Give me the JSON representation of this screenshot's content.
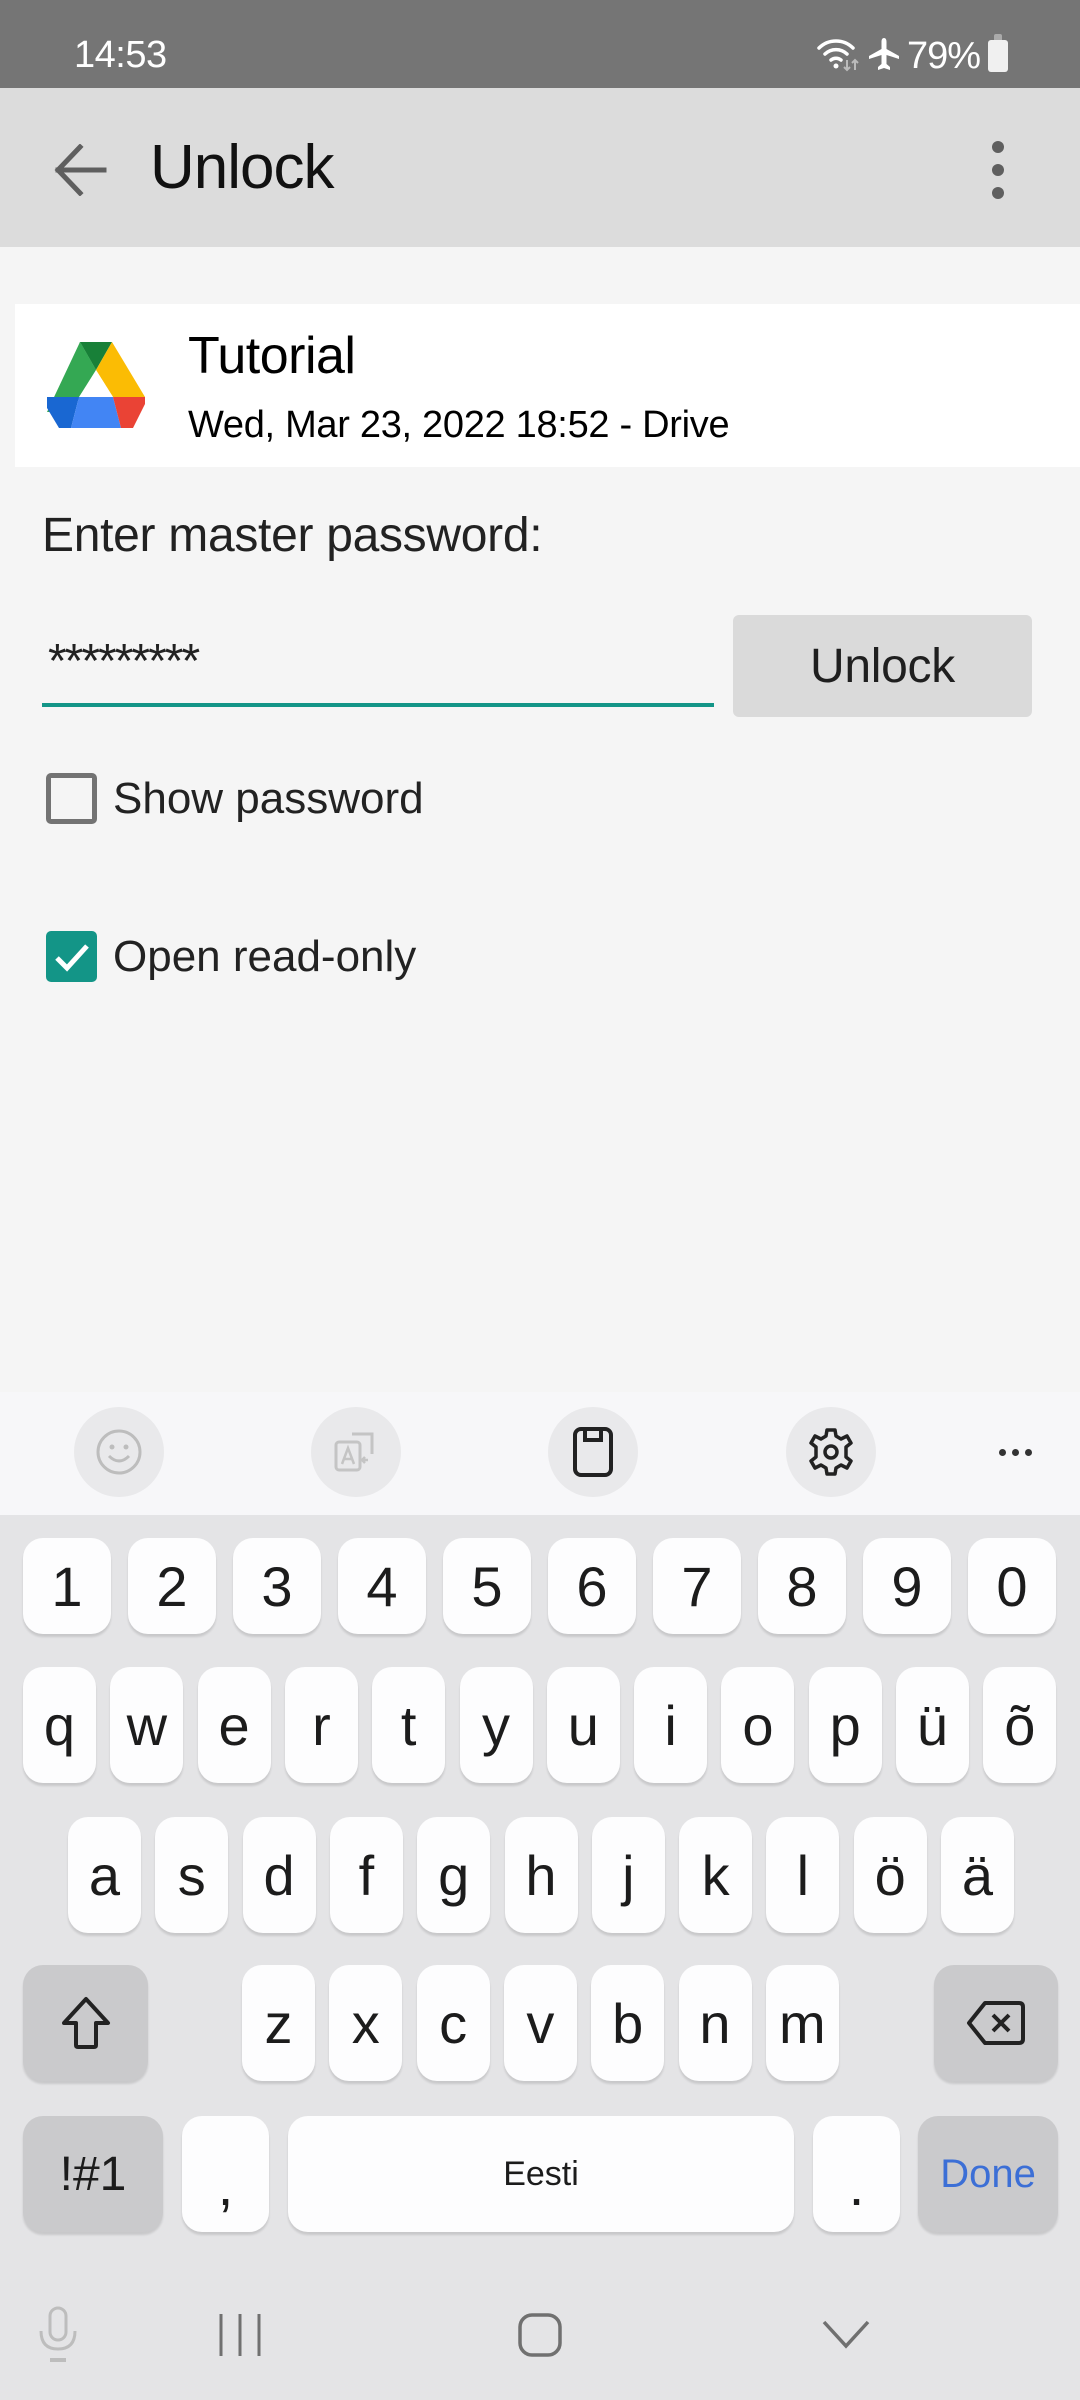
{
  "status_bar": {
    "time": "14:53",
    "battery": "79%",
    "icons": [
      "wifi-data-icon",
      "airplane-mode-icon",
      "battery-icon"
    ]
  },
  "app_bar": {
    "title": "Unlock",
    "back_icon": "arrow-back-icon",
    "menu_icon": "more-vert-icon"
  },
  "file": {
    "name": "Tutorial",
    "meta": "Wed, Mar 23, 2022 18:52 - Drive",
    "icon": "google-drive-icon"
  },
  "form": {
    "password_label": "Enter master password:",
    "password_value": "*********",
    "unlock_label": "Unlock",
    "show_password_label": "Show password",
    "show_password_checked": false,
    "read_only_label": "Open read-only",
    "read_only_checked": true,
    "accent_color": "#139587"
  },
  "keyboard_toolbar": {
    "items": [
      "emoji-icon",
      "translate-icon",
      "clipboard-icon",
      "settings-icon",
      "more-icon"
    ]
  },
  "keyboard": {
    "number_row": [
      "1",
      "2",
      "3",
      "4",
      "5",
      "6",
      "7",
      "8",
      "9",
      "0"
    ],
    "row1": [
      "q",
      "w",
      "e",
      "r",
      "t",
      "y",
      "u",
      "i",
      "o",
      "p",
      "ü",
      "õ"
    ],
    "row2": [
      "a",
      "s",
      "d",
      "f",
      "g",
      "h",
      "j",
      "k",
      "l",
      "ö",
      "ä"
    ],
    "row3": [
      "z",
      "x",
      "c",
      "v",
      "b",
      "n",
      "m"
    ],
    "symbols_label": "!#1",
    "comma_label": ",",
    "space_label": "Eesti",
    "period_label": ".",
    "done_label": "Done",
    "done_color": "#3c6fd6"
  },
  "nav_bar": {
    "items": [
      "microphone-icon",
      "recent-apps-icon",
      "home-icon",
      "hide-keyboard-icon"
    ]
  }
}
